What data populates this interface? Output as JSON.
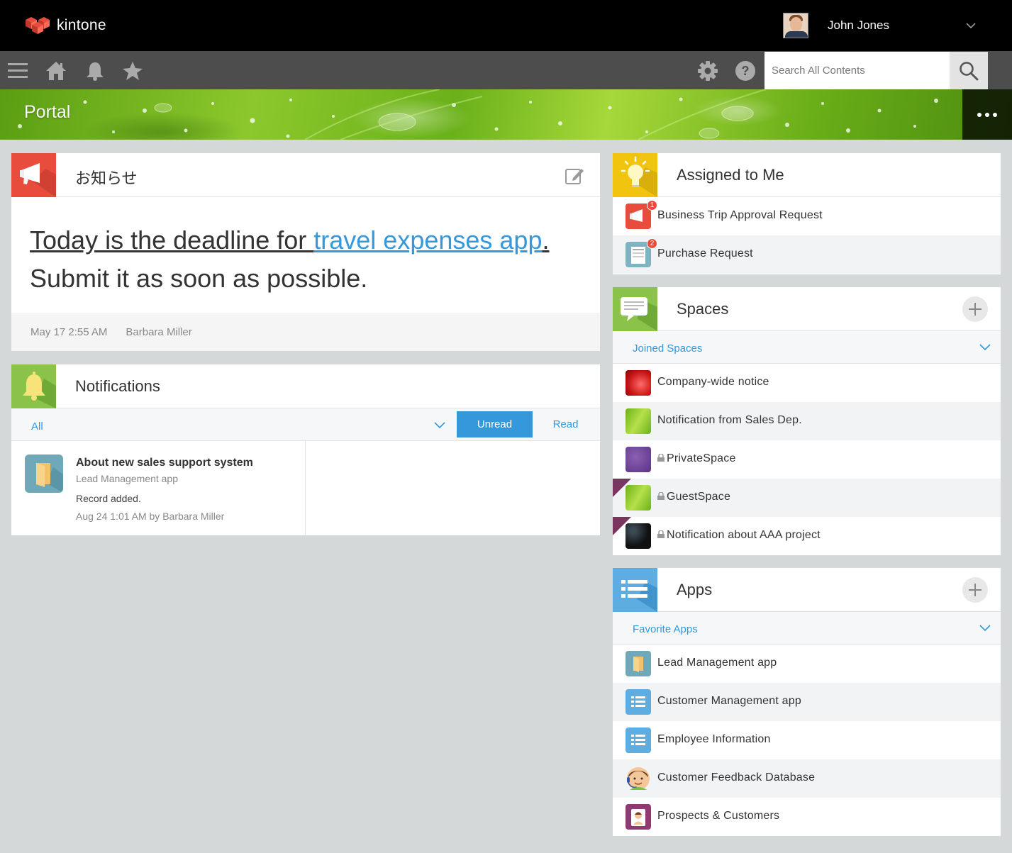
{
  "app": {
    "name": "kintone",
    "brand_color": "#e74c3c"
  },
  "user": {
    "name": "John Jones"
  },
  "search": {
    "placeholder": "Search All Contents"
  },
  "banner": {
    "title": "Portal"
  },
  "announcement": {
    "title": "お知らせ",
    "line1_prefix": "Today is the deadline for ",
    "line1_link": "travel expenses app",
    "line1_suffix": ".",
    "line2": "Submit it as soon as possible.",
    "date": "May 17 2:55 AM",
    "author": "Barbara Miller"
  },
  "notifications": {
    "title": "Notifications",
    "filter_label": "All",
    "tabs": {
      "unread": "Unread",
      "read": "Read"
    },
    "items": [
      {
        "title": "About new sales support system",
        "app": "Lead Management app",
        "desc": "Record added.",
        "meta": "Aug 24 1:01 AM  by Barbara Miller"
      }
    ]
  },
  "assigned": {
    "title": "Assigned to Me",
    "items": [
      {
        "label": "Business Trip Approval Request",
        "badge": "1",
        "icon": "megaphone-icon"
      },
      {
        "label": "Purchase Request",
        "badge": "2",
        "icon": "form-icon"
      }
    ]
  },
  "spaces": {
    "title": "Spaces",
    "sub_label": "Joined Spaces",
    "items": [
      {
        "label": "Company-wide notice",
        "icon": "red-flower-icon"
      },
      {
        "label": "Notification from Sales Dep.",
        "icon": "green-leaf-icon"
      },
      {
        "label": "PrivateSpace",
        "icon": "purple-texture-icon"
      },
      {
        "label": "GuestSpace",
        "icon": "green-leaf-icon"
      },
      {
        "label": "Notification about AAA project",
        "icon": "dark-texture-icon"
      }
    ]
  },
  "apps": {
    "title": "Apps",
    "sub_label": "Favorite Apps",
    "items": [
      {
        "label": "Lead Management app",
        "icon": "folder-icon"
      },
      {
        "label": "Customer Management app",
        "icon": "list-icon"
      },
      {
        "label": "Employee Information",
        "icon": "list-icon"
      },
      {
        "label": "Customer Feedback Database",
        "icon": "operator-icon"
      },
      {
        "label": "Prospects & Customers",
        "icon": "person-card-icon"
      }
    ]
  }
}
